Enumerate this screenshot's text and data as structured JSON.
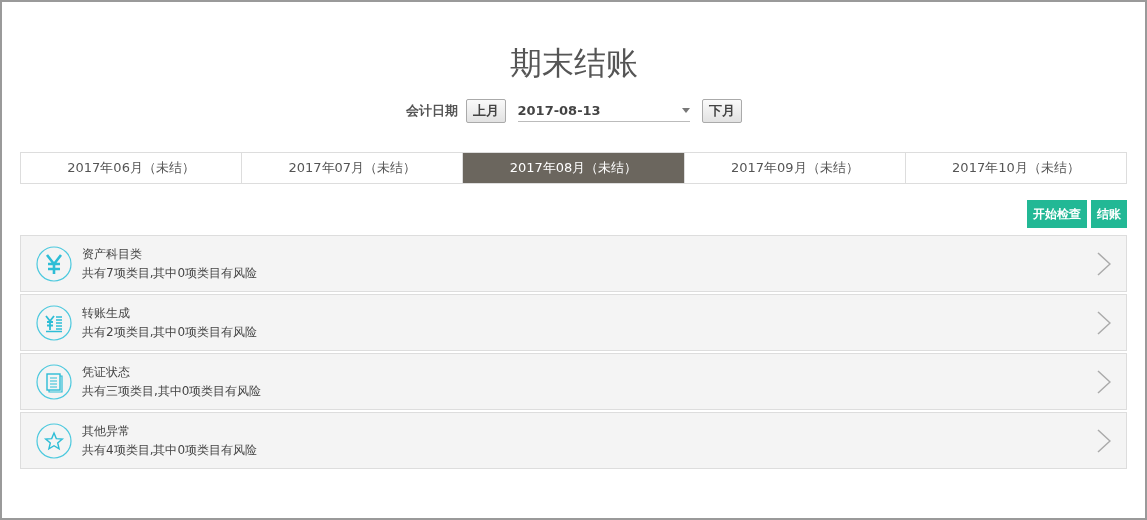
{
  "title": "期末结账",
  "date_bar": {
    "label": "会计日期",
    "prev_button": "上月",
    "date_value": "2017-08-13",
    "next_button": "下月"
  },
  "tabs": [
    {
      "label": "2017年06月（未结）",
      "selected": false
    },
    {
      "label": "2017年07月（未结）",
      "selected": false
    },
    {
      "label": "2017年08月（未结）",
      "selected": true
    },
    {
      "label": "2017年09月（未结）",
      "selected": false
    },
    {
      "label": "2017年10月（未结）",
      "selected": false
    }
  ],
  "actions": [
    "开始检查",
    "结账"
  ],
  "check_items": [
    {
      "kind": "yen",
      "title": "资产科目类",
      "summary": "共有7项类目,其中0项类目有风险"
    },
    {
      "kind": "yen-list",
      "title": "转账生成",
      "summary": "共有2项类目,其中0项类目有风险"
    },
    {
      "kind": "document",
      "title": "凭证状态",
      "summary": "共有三项类目,其中0项类目有风险"
    },
    {
      "kind": "star",
      "title": "其他异常",
      "summary": "共有4项类目,其中0项类目有风险"
    }
  ]
}
